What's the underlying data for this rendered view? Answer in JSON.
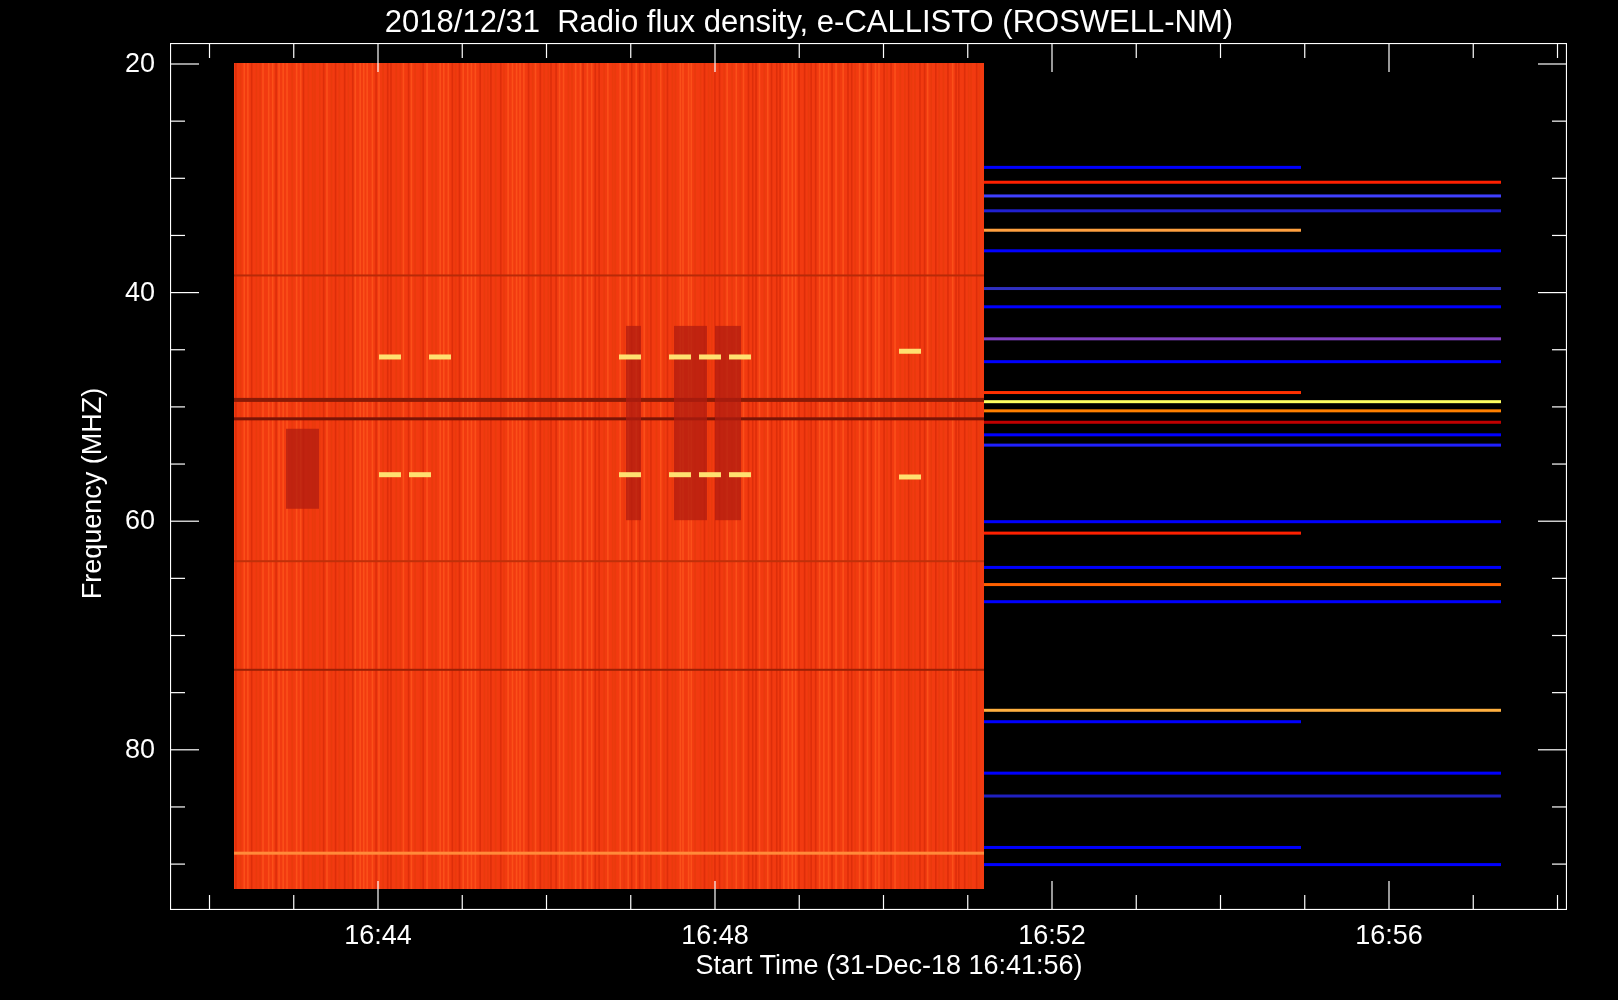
{
  "title": "2018/12/31  Radio flux density, e-CALLISTO (ROSWELL-NM)",
  "y_axis": {
    "label": "Frequency (MHZ)",
    "ticks": [
      "20",
      "40",
      "60",
      "80"
    ]
  },
  "x_axis": {
    "label": "Start Time (31-Dec-18 16:41:56)",
    "ticks": [
      "16:44",
      "16:48",
      "16:52",
      "16:56"
    ]
  }
}
